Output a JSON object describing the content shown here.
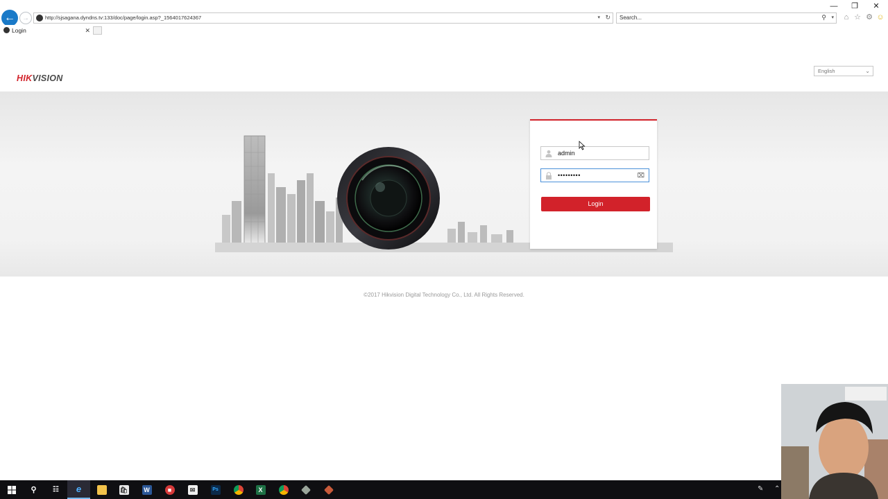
{
  "browser": {
    "address_url": "http://sjsagana.dyndns.tv:133/doc/page/login.asp?_1564017624367",
    "search_placeholder": "Search...",
    "tab_title": "Login",
    "back_icon": "back-arrow-icon",
    "forward_icon": "forward-arrow-icon"
  },
  "page": {
    "logo": {
      "hik": "HIK",
      "vision": "VISION"
    },
    "language": "English",
    "login": {
      "username_value": "admin",
      "password_value": "•••••••••",
      "button_label": "Login"
    },
    "footer": "©2017 Hikvision Digital Technology Co., Ltd. All Rights Reserved."
  },
  "taskbar": {
    "items": [
      "start",
      "search",
      "task-view",
      "internet-explorer",
      "file-explorer",
      "store",
      "word",
      "lock-app",
      "mail",
      "photoshop",
      "chrome",
      "excel",
      "chrome-2",
      "app-1",
      "app-2"
    ]
  },
  "colors": {
    "brand_red": "#d2222a",
    "ie_blue": "#1a7ac8",
    "taskbar": "#0f0f12"
  }
}
